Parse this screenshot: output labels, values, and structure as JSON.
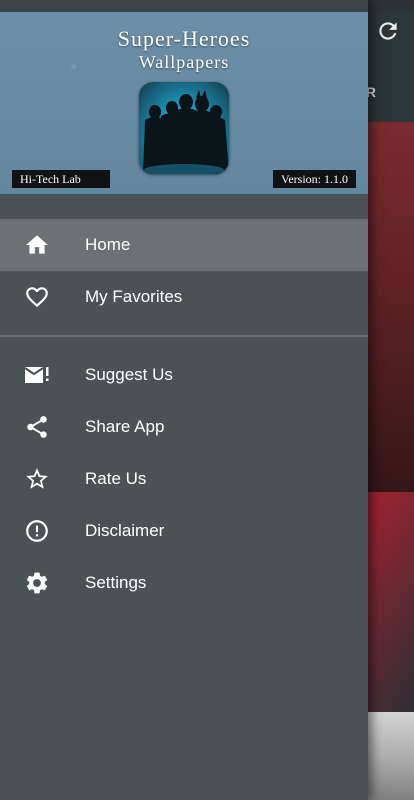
{
  "app": {
    "title_line1": "Super-Heroes",
    "title_line2": "Wallpapers",
    "lab": "Hi-Tech Lab",
    "version": "Version: 1.1.0"
  },
  "background": {
    "tab_partial": "R"
  },
  "menu": {
    "primary": [
      {
        "label": "Home",
        "icon": "home-icon",
        "active": true
      },
      {
        "label": "My Favorites",
        "icon": "heart-icon",
        "active": false
      }
    ],
    "secondary": [
      {
        "label": "Suggest Us",
        "icon": "mail-alert-icon"
      },
      {
        "label": "Share App",
        "icon": "share-icon"
      },
      {
        "label": "Rate Us",
        "icon": "star-icon"
      },
      {
        "label": "Disclaimer",
        "icon": "info-alert-icon"
      },
      {
        "label": "Settings",
        "icon": "gear-icon"
      }
    ]
  },
  "colors": {
    "drawer_bg": "#4a5255",
    "active_item_bg": "#6b7275",
    "header_bg": "#6487a0",
    "logo_glow": "#49d1ff"
  }
}
